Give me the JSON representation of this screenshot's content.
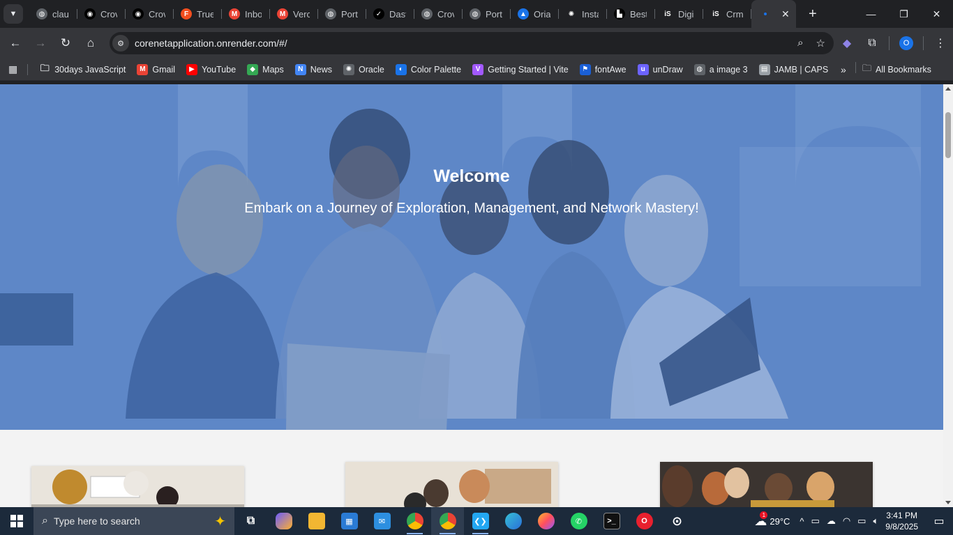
{
  "browser": {
    "tabs": [
      {
        "label": "clau",
        "icon": "globe-icon",
        "color": "#5f6368"
      },
      {
        "label": "Crov",
        "icon": "github-icon",
        "color": "#000000"
      },
      {
        "label": "Crov",
        "icon": "github-icon",
        "color": "#000000"
      },
      {
        "label": "True",
        "icon": "figma-icon",
        "color": "#f24e1e"
      },
      {
        "label": "Inbo",
        "icon": "gmail-icon",
        "color": "#ea4335"
      },
      {
        "label": "Verc",
        "icon": "gmail-icon",
        "color": "#ea4335"
      },
      {
        "label": "Port",
        "icon": "globe-icon",
        "color": "#5f6368"
      },
      {
        "label": "Dast",
        "icon": "check-circle-icon",
        "color": "#000000"
      },
      {
        "label": "Crov",
        "icon": "globe-icon",
        "color": "#5f6368"
      },
      {
        "label": "Port",
        "icon": "globe-icon",
        "color": "#5f6368"
      },
      {
        "label": "Oria",
        "icon": "rocket-icon",
        "color": "#1a73e8"
      },
      {
        "label": "Insta",
        "icon": "openai-icon",
        "color": "#202124"
      },
      {
        "label": "Best",
        "icon": "bookshelf-icon",
        "color": "#000000"
      },
      {
        "label": "Digi",
        "icon": "is-icon",
        "color": "#202124"
      },
      {
        "label": "Crm",
        "icon": "is-icon",
        "color": "#202124"
      }
    ],
    "new_tab_symbol": "+",
    "url": "corenetapplication.onrender.com/#/",
    "profile_initial": "O",
    "bookmarks": [
      {
        "label": "30days JavaScript",
        "icon": "folder-icon"
      },
      {
        "label": "Gmail",
        "icon": "gmail-icon"
      },
      {
        "label": "YouTube",
        "icon": "youtube-icon"
      },
      {
        "label": "Maps",
        "icon": "maps-icon"
      },
      {
        "label": "News",
        "icon": "news-icon"
      },
      {
        "label": "Oracle",
        "icon": "openai-icon"
      },
      {
        "label": "Color Palette",
        "icon": "palette-icon"
      },
      {
        "label": "Getting Started | Vite",
        "icon": "vite-icon"
      },
      {
        "label": "fontAwe",
        "icon": "flag-icon"
      },
      {
        "label": "unDraw",
        "icon": "undraw-icon"
      },
      {
        "label": "a image 3",
        "icon": "globe-icon"
      },
      {
        "label": "JAMB | CAPS",
        "icon": "document-icon"
      }
    ],
    "all_bookmarks_label": "All Bookmarks"
  },
  "page": {
    "hero": {
      "title": "Welcome",
      "subtitle": "Embark on a Journey of Exploration, Management, and Network Mastery!",
      "overlay_color": "#5b83c5"
    }
  },
  "taskbar": {
    "search_placeholder": "Type here to search",
    "temperature": "29°C",
    "weather_badge": "1",
    "time": "3:41 PM",
    "date": "9/8/2025"
  }
}
